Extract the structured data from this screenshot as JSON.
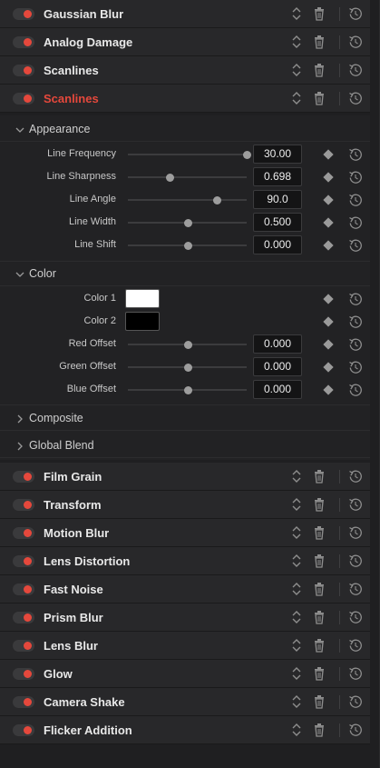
{
  "effects_top": [
    {
      "name": "Gaussian Blur",
      "enabled": true,
      "active": false
    },
    {
      "name": "Analog Damage",
      "enabled": true,
      "active": false
    },
    {
      "name": "Scanlines",
      "enabled": true,
      "active": false
    },
    {
      "name": "Scanlines",
      "enabled": true,
      "active": true
    }
  ],
  "inspector": {
    "appearance": {
      "label": "Appearance",
      "expanded": true,
      "params": [
        {
          "label": "Line Frequency",
          "value": "30.00",
          "slider_fraction": 1.0
        },
        {
          "label": "Line Sharpness",
          "value": "0.698",
          "slider_fraction": 0.35
        },
        {
          "label": "Line Angle",
          "value": "90.0",
          "slider_fraction": 0.75
        },
        {
          "label": "Line Width",
          "value": "0.500",
          "slider_fraction": 0.5
        },
        {
          "label": "Line Shift",
          "value": "0.000",
          "slider_fraction": 0.5
        }
      ]
    },
    "color": {
      "label": "Color",
      "expanded": true,
      "swatches": [
        {
          "label": "Color 1",
          "color": "#ffffff"
        },
        {
          "label": "Color 2",
          "color": "#000000"
        }
      ],
      "params": [
        {
          "label": "Red Offset",
          "value": "0.000",
          "slider_fraction": 0.5
        },
        {
          "label": "Green Offset",
          "value": "0.000",
          "slider_fraction": 0.5
        },
        {
          "label": "Blue Offset",
          "value": "0.000",
          "slider_fraction": 0.5
        }
      ]
    },
    "composite": {
      "label": "Composite",
      "expanded": false
    },
    "global_blend": {
      "label": "Global Blend",
      "expanded": false
    }
  },
  "effects_bottom": [
    {
      "name": "Film Grain",
      "enabled": true
    },
    {
      "name": "Transform",
      "enabled": true
    },
    {
      "name": "Motion Blur",
      "enabled": true
    },
    {
      "name": "Lens Distortion",
      "enabled": true
    },
    {
      "name": "Fast Noise",
      "enabled": true
    },
    {
      "name": "Prism Blur",
      "enabled": true
    },
    {
      "name": "Lens Blur",
      "enabled": true
    },
    {
      "name": "Glow",
      "enabled": true
    },
    {
      "name": "Camera Shake",
      "enabled": true
    },
    {
      "name": "Flicker Addition",
      "enabled": true
    }
  ],
  "icons": {
    "toggle": "toggle-switch-icon",
    "sort": "sort-up-down-icon",
    "trash": "trash-icon",
    "reset": "reset-icon",
    "keyframe": "keyframe-diamond-icon",
    "chevron_down": "chevron-down-icon",
    "chevron_right": "chevron-right-icon"
  },
  "colors": {
    "accent_red": "#e5483c",
    "panel_bg": "#1f1f21",
    "row_bg": "#28282a"
  }
}
